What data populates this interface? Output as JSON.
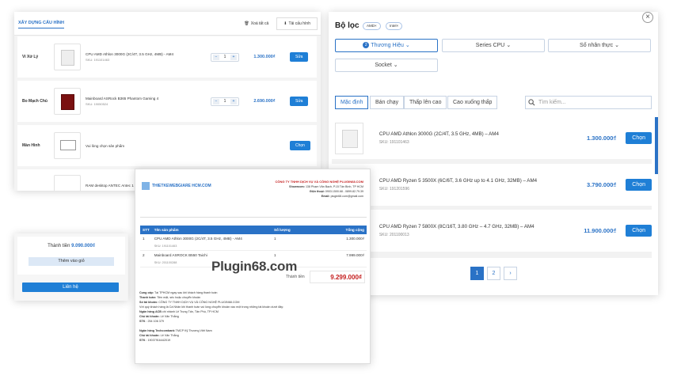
{
  "builder": {
    "tab": "XÂY DỰNG CẤU HÌNH",
    "clear_all": "Xoá tất cả",
    "download": "Tải cấu hình",
    "rows": [
      {
        "category": "Vi Xử Lý",
        "name": "CPU AMD Athlon 3000G (2C/4T, 3.5 GHz, 4MB) - AM4",
        "sku": "SKU: 191101463",
        "qty": "1",
        "price": "1.300.000₫",
        "button": "Sửa"
      },
      {
        "category": "Bo Mạch Chủ",
        "name": "Mainboard ASRock B365 Phantom Gaming 4",
        "sku": "SKU: 19050524",
        "qty": "1",
        "price": "2.690.000₫",
        "button": "Sửa"
      },
      {
        "category": "Màn Hình",
        "name": "Vui lòng chọn sản phẩm",
        "button": "Chọn"
      },
      {
        "name": "RAM desktop ANTEC Antec 1"
      }
    ]
  },
  "total": {
    "label": "Thành tiền",
    "value": "9.090.000₫",
    "add_cart": "Thêm vào giỏ",
    "contact": "Liên hệ"
  },
  "filter": {
    "title": "Bộ lọc",
    "chips": [
      "AMD",
      "Intel"
    ],
    "dropdowns": [
      {
        "label": "Thương Hiệu",
        "badge": "2"
      },
      {
        "label": "Series CPU"
      },
      {
        "label": "Số nhân thực"
      },
      {
        "label": "Socket"
      }
    ],
    "sorts": [
      "Mặc định",
      "Bán chạy",
      "Thấp lên cao",
      "Cao xuống thấp"
    ],
    "search_placeholder": "Tìm kiếm...",
    "products": [
      {
        "name": "CPU AMD Athlon 3000G (2C/4T, 3.5 GHz, 4MB) – AM4",
        "sku": "SKU: 191101463",
        "price": "1.300.000₫",
        "button": "Chọn"
      },
      {
        "name": "CPU AMD Ryzen 5 3500X (6C/6T, 3.6 GHz up to 4.1 GHz, 32MB) – AM4",
        "sku": "SKU: 191201596",
        "price": "3.790.000₫",
        "button": "Chọn"
      },
      {
        "name": "CPU AMD Ryzen 7 5800X (8C/16T, 3.80 GHz – 4.7 GHz, 32MB) – AM4",
        "sku": "SKU: 201100013",
        "price": "11.900.000₫",
        "button": "Chọn"
      }
    ],
    "pages": [
      "1",
      "2"
    ],
    "next": "›"
  },
  "invoice": {
    "logo": "THIETKEWEBGIARE HCM.COM",
    "company": "CÔNG TY TNHH DỊCH VỤ VÀ CÔNG NGHỆ PLUGIN68.COM",
    "showroom_label": "Showroom:",
    "showroom": "138 Phạm Văn Bạch, P.15 Tân Bình, TP HCM",
    "phone_label": "Điện thoại:",
    "phone": "0903.1500.68 - 0899.82.79.39",
    "email_label": "Email:",
    "email": "plugin68.com@gmail.com",
    "columns": [
      "STT",
      "Tên sản phẩm",
      "Số lượng",
      "Tổng cộng"
    ],
    "items": [
      {
        "stt": "1",
        "name": "CPU AMD Athlon 3000G (2C/4T, 3.5 GHz, 4MB) - AM4",
        "sku": "SKU: 191101463",
        "qty": "1",
        "total": "1.300.000₫"
      },
      {
        "stt": "2",
        "name": "Mainboard ASROCK B550 Taichi",
        "sku": "SKU: 201100288",
        "qty": "1",
        "total": "7.999.000₫"
      }
    ],
    "watermark": "Plugin68.com",
    "grand_label": "Thành tiền",
    "grand_total": "9.299.000₫",
    "notes": [
      {
        "label": "Cung cấp:",
        "text": "Tại TPHCM ngay sau khi khách hàng thanh toán"
      },
      {
        "label": "Thanh toán:",
        "text": "Tiền mặt, séc hoặc chuyển khoản"
      },
      {
        "label": "Số tài khoản:",
        "text": "CÔNG TY TNHH DỊCH VỤ VÀ CÔNG NGHỆ PLUGIN68.COM"
      },
      {
        "label": "",
        "text": "Với quý khách hàng là Cá Nhân khi thanh toán vui lòng chuyển khoản vào một trong những tài khoản dưới đây:"
      },
      {
        "label": "Ngân hàng ACB",
        "text": "chi nhánh Lê Trọng Tấn, Tân Phú, TP HCM"
      },
      {
        "label": "Chủ tài khoản:",
        "text": "Lê Văn Thắng"
      },
      {
        "label": "STK",
        "text": ": 254 106 379"
      },
      {
        "label": "",
        "text": ""
      },
      {
        "label": "Ngân hàng Techcombank",
        "text": "TMCP Kỹ Thương Việt Nam"
      },
      {
        "label": "Chủ tài khoản:",
        "text": "Lê Văn Thắng"
      },
      {
        "label": "STK",
        "text": ": 19037916442019"
      }
    ]
  }
}
